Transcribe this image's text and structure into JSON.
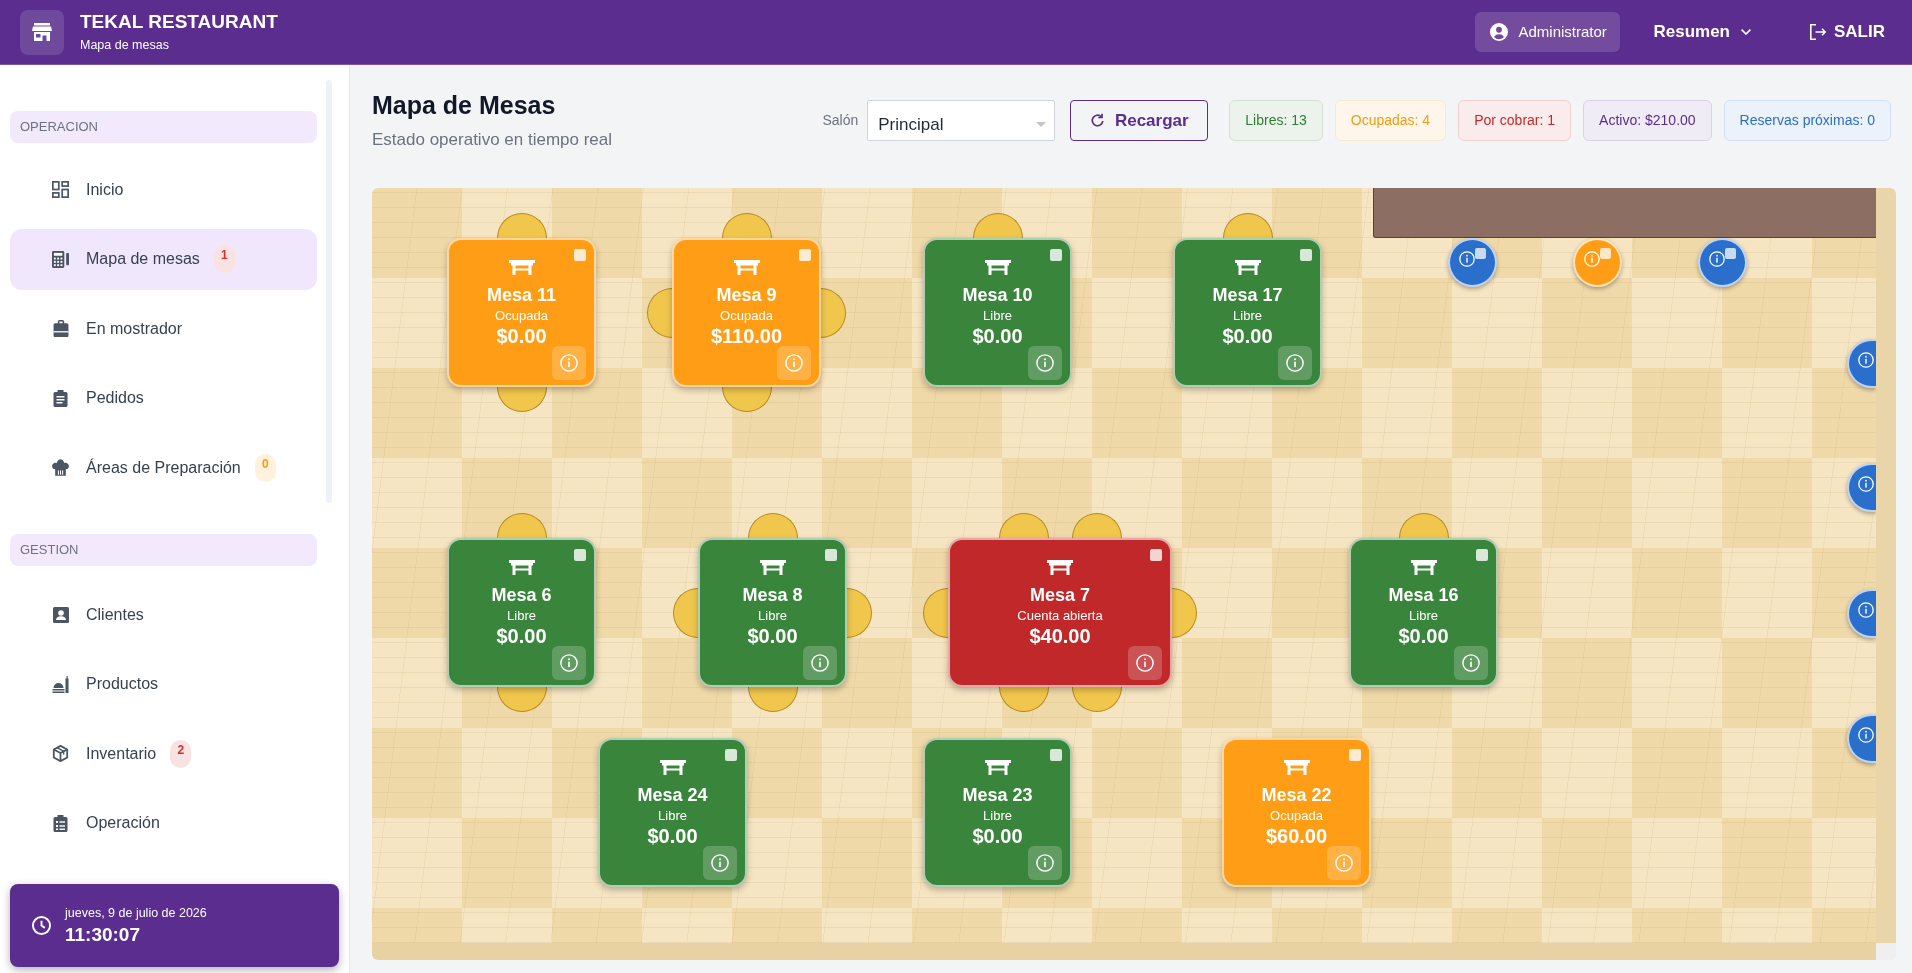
{
  "header": {
    "title": "TEKAL RESTAURANT",
    "subtitle": "Mapa de mesas",
    "user": "Administrator",
    "menu": "Resumen",
    "logout": "SALIR"
  },
  "sidebar": {
    "sections": [
      {
        "title": "OPERACION",
        "items": [
          {
            "label": "Inicio",
            "selected": false
          },
          {
            "label": "Mapa de mesas",
            "selected": true,
            "badge": {
              "text": "1",
              "color": "#d32f2f"
            }
          },
          {
            "label": "En mostrador",
            "selected": false
          },
          {
            "label": "Pedidos",
            "selected": false
          },
          {
            "label": "Áreas de Preparación",
            "selected": false,
            "badge": {
              "text": "0",
              "color": "#f59e0b"
            }
          }
        ]
      },
      {
        "title": "GESTION",
        "items": [
          {
            "label": "Clientes",
            "selected": false
          },
          {
            "label": "Productos",
            "selected": false
          },
          {
            "label": "Inventario",
            "selected": false,
            "badge": {
              "text": "2",
              "color": "#d32f2f"
            }
          },
          {
            "label": "Operación",
            "selected": false
          }
        ]
      }
    ],
    "clock": {
      "date": "jueves, 9 de julio de 2026",
      "time": "11:30:07"
    }
  },
  "page": {
    "title": "Mapa de Mesas",
    "subtitle": "Estado operativo en tiempo real"
  },
  "toolbar": {
    "salon": {
      "label": "Salón",
      "value": "Principal"
    },
    "reload": "Recargar",
    "summary": [
      {
        "text": "Libres: 13",
        "color": "#2e7d32"
      },
      {
        "text": "Ocupadas: 4",
        "color": "#f39c12"
      },
      {
        "text": "Por cobrar: 1",
        "color": "#c62828"
      },
      {
        "text": "Activo: $210.00",
        "color": "#5b2d8e"
      },
      {
        "text": "Reservas próximas: 0",
        "color": "#2a6fc4"
      }
    ]
  },
  "floor": {
    "tables": [
      {
        "name": "Mesa 11",
        "status": "Ocupada",
        "amount": "$0.00",
        "color": "#ff9e16",
        "checked": false
      },
      {
        "name": "Mesa 9",
        "status": "Ocupada",
        "amount": "$110.00",
        "color": "#ff9e16",
        "checked": false
      },
      {
        "name": "Mesa 10",
        "status": "Libre",
        "amount": "$0.00",
        "color": "#3a853c",
        "checked": false
      },
      {
        "name": "Mesa 17",
        "status": "Libre",
        "amount": "$0.00",
        "color": "#3a853c",
        "checked": false
      },
      {
        "name": "Mesa 6",
        "status": "Libre",
        "amount": "$0.00",
        "color": "#3a853c",
        "checked": false
      },
      {
        "name": "Mesa 8",
        "status": "Libre",
        "amount": "$0.00",
        "color": "#3a853c",
        "checked": false
      },
      {
        "name": "Mesa 7",
        "status": "Cuenta abierta",
        "amount": "$40.00",
        "color": "#c0282a",
        "checked": false
      },
      {
        "name": "Mesa 16",
        "status": "Libre",
        "amount": "$0.00",
        "color": "#3a853c",
        "checked": false
      },
      {
        "name": "Mesa 24",
        "status": "Libre",
        "amount": "$0.00",
        "color": "#3a853c",
        "checked": false
      },
      {
        "name": "Mesa 23",
        "status": "Libre",
        "amount": "$0.00",
        "color": "#3a853c",
        "checked": false
      },
      {
        "name": "Mesa 22",
        "status": "Ocupada",
        "amount": "$60.00",
        "color": "#ff9e16",
        "checked": false
      }
    ],
    "stools": [
      {
        "color": "#2a6fcb",
        "checked": false
      },
      {
        "color": "#ff9e16",
        "checked": false
      },
      {
        "color": "#2a6fcb",
        "checked": false
      },
      {
        "color": "#2a6fcb"
      },
      {
        "color": "#2a6fcb"
      },
      {
        "color": "#2a6fcb"
      },
      {
        "color": "#2a6fcb"
      }
    ]
  }
}
